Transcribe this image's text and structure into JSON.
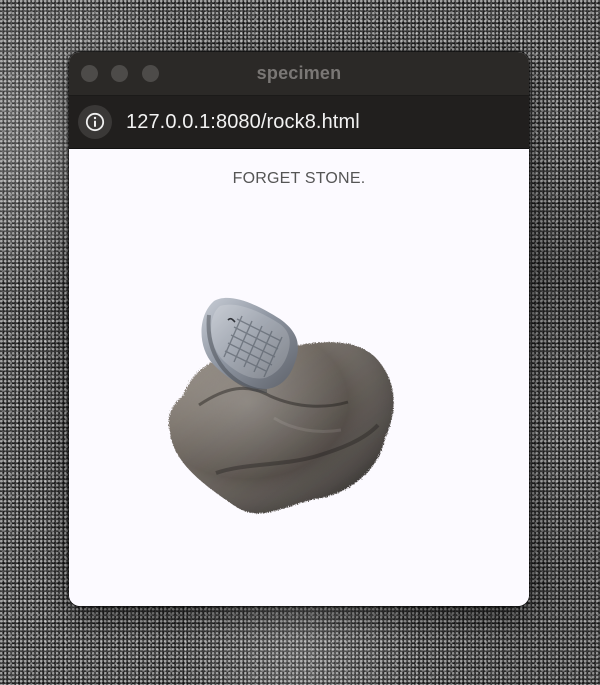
{
  "window": {
    "title": "specimen"
  },
  "addressbar": {
    "url": "127.0.0.1:8080/rock8.html",
    "icon": "info-icon"
  },
  "page": {
    "caption": "FORGET STONE."
  },
  "specimen_image": {
    "subject": "stone"
  },
  "colors": {
    "titlebar": "#2b2927",
    "addressbar": "#211f1e",
    "page_background": "#fcfaff",
    "caption_text": "#555555"
  }
}
